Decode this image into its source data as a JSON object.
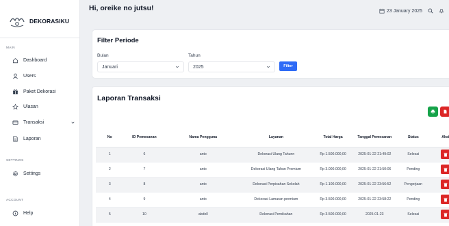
{
  "brand": {
    "name": "DEKORASIKU"
  },
  "sidebar": {
    "sections": {
      "main": "MAIN",
      "settings": "SETTINGS",
      "account": "ACCOUNT"
    },
    "items": [
      {
        "label": "Dashboard",
        "icon": "home-icon"
      },
      {
        "label": "Users",
        "icon": "user-icon"
      },
      {
        "label": "Paket Dekorasi",
        "icon": "gift-icon"
      },
      {
        "label": "Ulasan",
        "icon": "star-icon"
      },
      {
        "label": "Transaksi",
        "icon": "card-icon"
      },
      {
        "label": "Laporan",
        "icon": "document-icon"
      },
      {
        "label": "Settings",
        "icon": "gear-icon"
      },
      {
        "label": "Help",
        "icon": "help-icon"
      }
    ]
  },
  "header": {
    "greeting": "Hi, oreike no jutsu!",
    "date": "23 January 2025"
  },
  "filter": {
    "title": "Filter Periode",
    "month_label": "Bulan",
    "month_value": "Januari",
    "year_label": "Tahun",
    "year_value": "2025",
    "button": "Filter"
  },
  "report": {
    "title": "Laporan Transaksi",
    "columns": [
      "No",
      "ID Pemesanan",
      "Nama Pengguna",
      "Layanan",
      "Total Harga",
      "Tanggal Pemesanan",
      "Status",
      "Aksi"
    ],
    "rows": [
      {
        "no": "1",
        "id": "6",
        "user": "anto",
        "service": "Dekorasi Ulang Tahunn",
        "total": "Rp 1.500.000,00",
        "date": "2025-01-22 21:49:02",
        "status": "Selesai"
      },
      {
        "no": "2",
        "id": "7",
        "user": "anto",
        "service": "Dekorasi Ulang Tahun Premium",
        "total": "Rp 3.000.000,00",
        "date": "2025-01-22 21:50:06",
        "status": "Pending"
      },
      {
        "no": "3",
        "id": "8",
        "user": "anto",
        "service": "Dekorasi Perpisahan Sekolah",
        "total": "Rp 1.100.000,00",
        "date": "2025-01-22 23:56:52",
        "status": "Pengerjaan"
      },
      {
        "no": "4",
        "id": "9",
        "user": "anto",
        "service": "Dekorasi Lamaran premium",
        "total": "Rp 3.500.000,00",
        "date": "2025-01-22 23:58:22",
        "status": "Pending"
      },
      {
        "no": "5",
        "id": "10",
        "user": "abdoll",
        "service": "Dekorasi Pernikahan",
        "total": "Rp 3.500.000,00",
        "date": "2025-01-23 ",
        "status": "Selesai"
      }
    ]
  },
  "colors": {
    "primary": "#2f6bf6",
    "success": "#16a34a",
    "danger": "#dc2626"
  }
}
